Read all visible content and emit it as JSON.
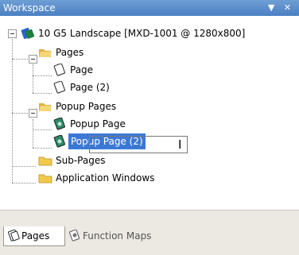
{
  "panel": {
    "title": "Workspace",
    "controls": "▼ ✕"
  },
  "tree": {
    "root": "10 G5 Landscape [MXD-1001 @ 1280x800]",
    "pages_folder": "Pages",
    "page_1": "Page",
    "page_2": "Page (2)",
    "popup_folder": "Popup Pages",
    "popup_1": "Popup Page",
    "popup_2": "Popup Page (2)",
    "subpages_folder": "Sub-Pages",
    "appwin_folder": "Application Windows"
  },
  "tabs": {
    "pages": "Pages",
    "function_maps": "Function Maps"
  },
  "colors": {
    "titlebar": "#4a7fc2",
    "selection": "#3b78d6",
    "folder": "#f2c94c"
  }
}
